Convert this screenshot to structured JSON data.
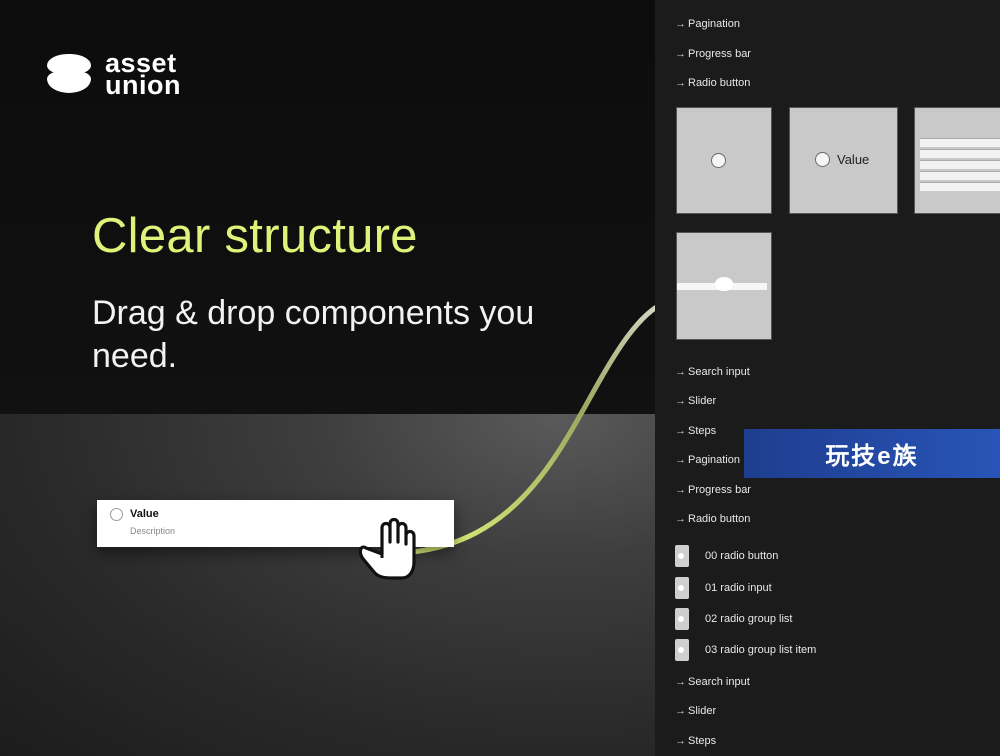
{
  "brand": {
    "line1": "asset",
    "line2": "union"
  },
  "hero": {
    "headline": "Clear structure",
    "subhead": "Drag & drop components you need."
  },
  "drag_card": {
    "label": "Value",
    "description": "Description"
  },
  "arrow_glyph": "→",
  "panel": {
    "nav_top": [
      "Pagination",
      "Progress bar",
      "Radio button"
    ],
    "thumb_value_label": "Value",
    "nav_mid": [
      "Search input",
      "Slider",
      "Steps",
      "Pagination",
      "Progress bar",
      "Radio button"
    ],
    "layers": [
      "00 radio button",
      "01 radio input",
      "02 radio group list",
      "03 radio group list item"
    ],
    "nav_bottom": [
      "Search input",
      "Slider",
      "Steps"
    ]
  },
  "watermark": {
    "text": "玩技e族"
  },
  "colors": {
    "accent": "#dff27a",
    "background": "#151515",
    "panel": "#1b1b1b",
    "watermark": "#2855b8"
  },
  "icons": [
    "brand-logo-icon",
    "grab-hand-icon",
    "arrow-right-icon",
    "radio-icon"
  ]
}
